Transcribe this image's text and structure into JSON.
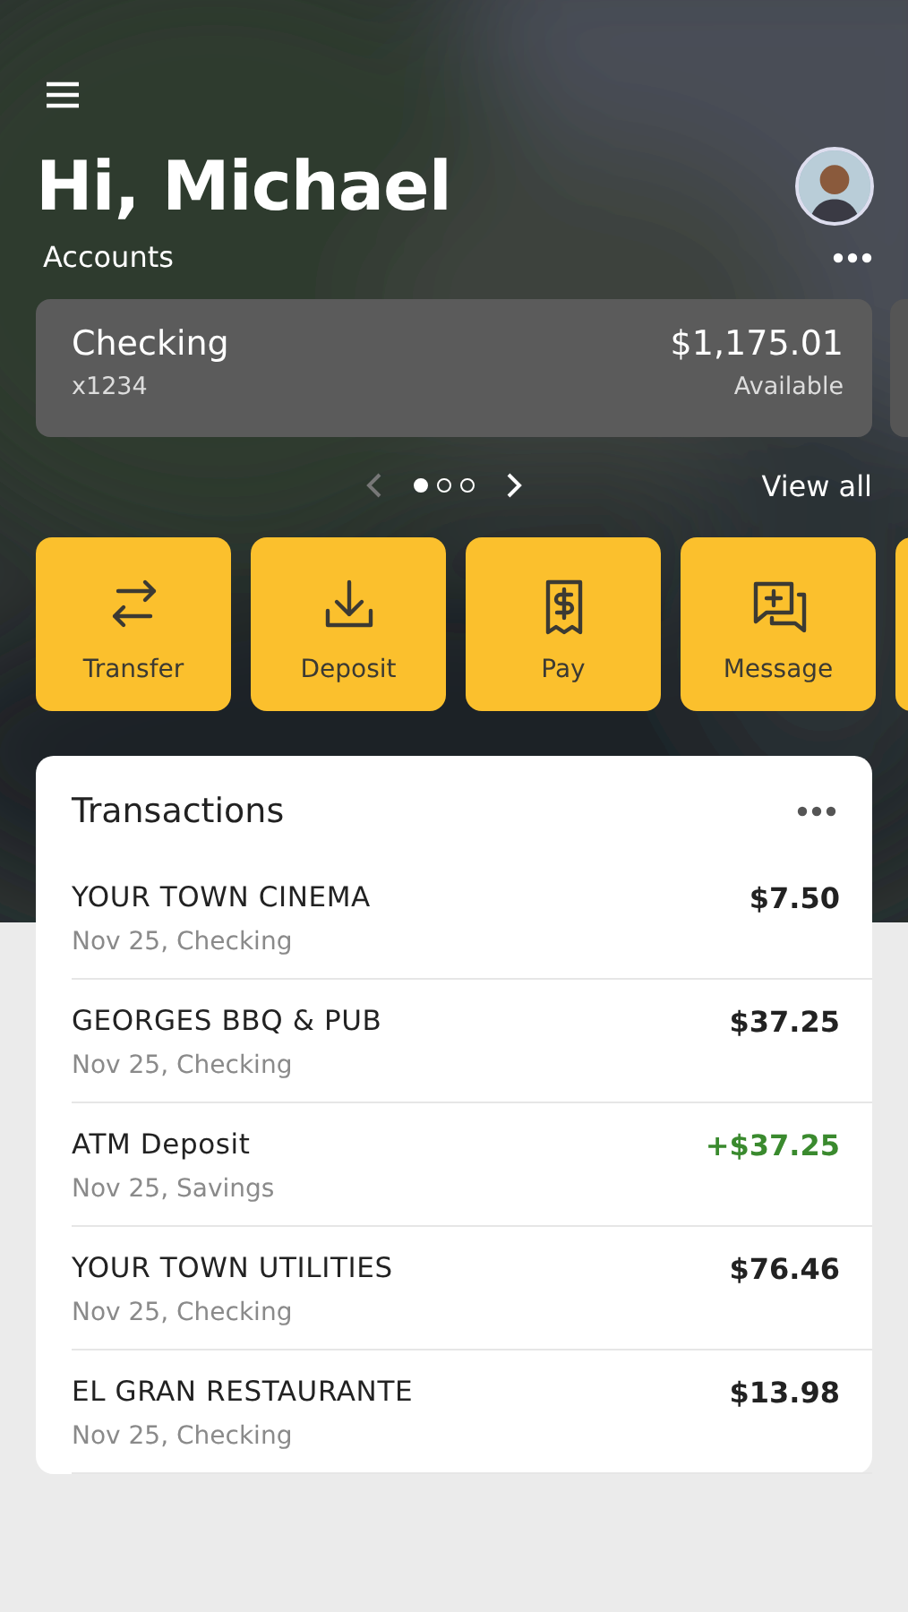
{
  "greeting": "Hi, Michael",
  "accounts": {
    "title": "Accounts",
    "cards": [
      {
        "name": "Checking",
        "number": "x1234",
        "balance": "$1,175.01",
        "balance_label": "Available"
      }
    ],
    "pager": {
      "prev_disabled": true,
      "dots": [
        {
          "selected": true
        },
        {
          "selected": false
        },
        {
          "selected": false
        }
      ]
    },
    "view_all": "View all"
  },
  "actions": [
    {
      "kind": "transfer",
      "label": "Transfer"
    },
    {
      "kind": "deposit",
      "label": "Deposit"
    },
    {
      "kind": "pay",
      "label": "Pay"
    },
    {
      "kind": "message",
      "label": "Message"
    }
  ],
  "transactions": {
    "title": "Transactions",
    "rows": [
      {
        "name": "YOUR TOWN CINEMA",
        "detail": "Nov 25, Checking",
        "amount": "$7.50",
        "kind": "debit"
      },
      {
        "name": "GEORGES BBQ & PUB",
        "detail": "Nov 25, Checking",
        "amount": "$37.25",
        "kind": "debit"
      },
      {
        "name": "ATM Deposit",
        "detail": "Nov 25, Savings",
        "amount": "+$37.25",
        "kind": "credit"
      },
      {
        "name": "YOUR TOWN UTILITIES",
        "detail": "Nov 25, Checking",
        "amount": "$76.46",
        "kind": "debit"
      },
      {
        "name": "EL GRAN RESTAURANTE",
        "detail": "Nov 25, Checking",
        "amount": "$13.98",
        "kind": "debit"
      }
    ]
  }
}
